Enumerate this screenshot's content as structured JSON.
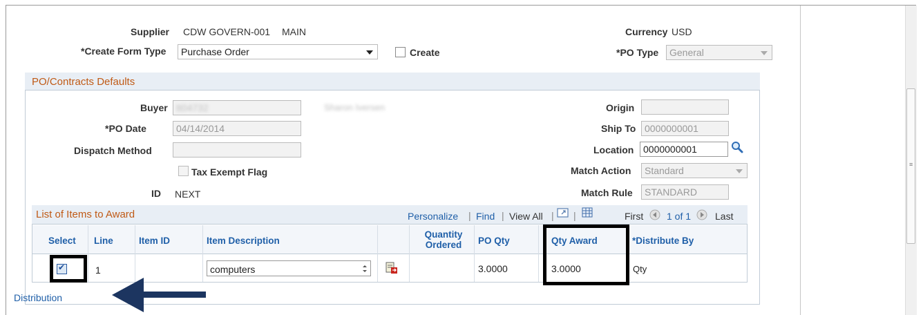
{
  "header": {
    "supplier_label": "Supplier",
    "supplier_value": "CDW GOVERN-001",
    "supplier_location": "MAIN",
    "currency_label": "Currency",
    "currency_value": "USD",
    "create_form_type_label": "*Create Form Type",
    "create_form_type_value": "Purchase Order",
    "create_label": "Create",
    "po_type_label": "*PO Type",
    "po_type_value": "General"
  },
  "defaults": {
    "section_title": "PO/Contracts Defaults",
    "buyer_label": "Buyer",
    "buyer_value": "tt04732",
    "buyer_name": "Sharon Iversen",
    "po_date_label": "*PO Date",
    "po_date_value": "04/14/2014",
    "dispatch_method_label": "Dispatch Method",
    "dispatch_method_value": "",
    "tax_exempt_label": "Tax Exempt Flag",
    "id_label": "ID",
    "id_value": "NEXT",
    "origin_label": "Origin",
    "origin_value": "",
    "ship_to_label": "Ship To",
    "ship_to_value": "0000000001",
    "location_label": "Location",
    "location_value": "0000000001",
    "match_action_label": "Match Action",
    "match_action_value": "Standard",
    "match_rule_label": "Match Rule",
    "match_rule_value": "STANDARD"
  },
  "grid": {
    "title": "List of Items to Award",
    "personalize": "Personalize",
    "find": "Find",
    "view_all": "View All",
    "first": "First",
    "page_info": "1 of 1",
    "last": "Last",
    "columns": {
      "select": "Select",
      "line": "Line",
      "item_id": "Item ID",
      "item_description": "Item Description",
      "quantity_ordered": "Quantity Ordered",
      "po_qty": "PO Qty",
      "qty_award": "Qty Award",
      "distribute_by": "*Distribute By"
    },
    "rows": [
      {
        "selected": true,
        "line": "1",
        "item_id": "",
        "item_description": "computers",
        "quantity_ordered": "",
        "po_qty": "3.0000",
        "qty_award": "3.0000",
        "distribute_by": "Qty"
      }
    ]
  },
  "distribution_link": "Distribution",
  "icons": [
    "search-icon",
    "comments-icon",
    "zoom-icon",
    "download-grid-icon",
    "prev-page-icon",
    "next-page-icon",
    "spinner-icon",
    "checkbox-icon",
    "annotation-arrow-icon"
  ]
}
